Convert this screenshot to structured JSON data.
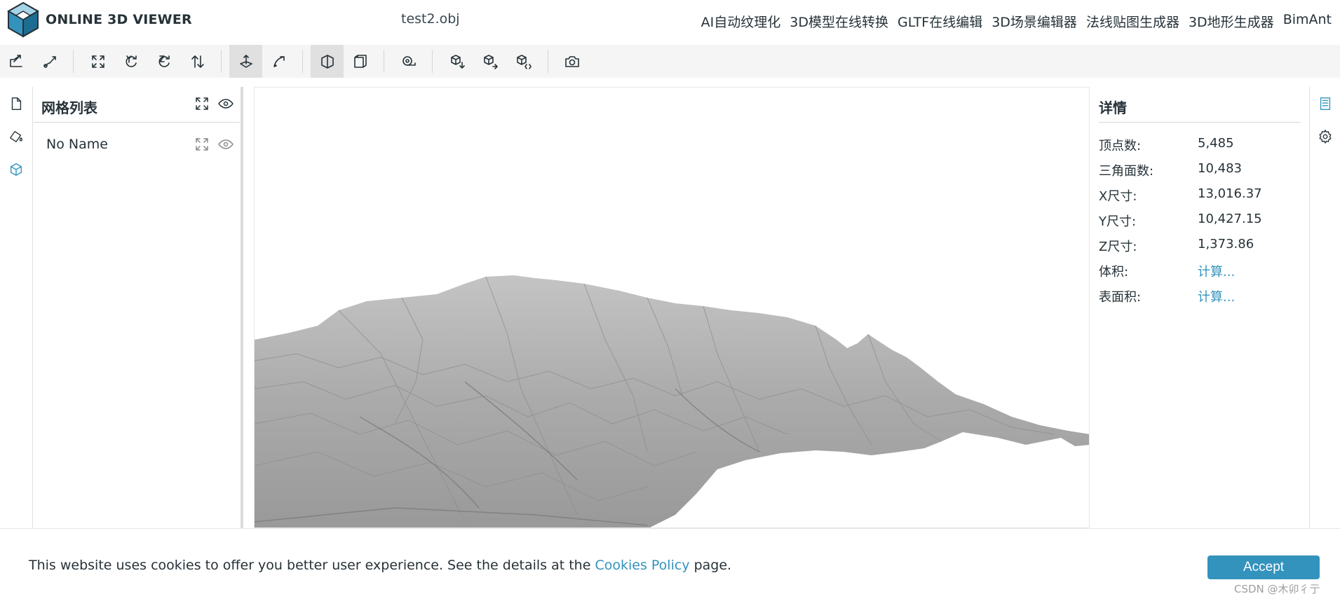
{
  "header": {
    "logo_text": "ONLINE 3D VIEWER",
    "file_title": "test2.obj",
    "nav": [
      "AI自动纹理化",
      "3D模型在线转换",
      "GLTF在线编辑",
      "3D场景编辑器",
      "法线贴图生成器",
      "3D地形生成器",
      "BimAnt"
    ]
  },
  "toolbar": {
    "buttons": [
      {
        "icon": "open-file-icon"
      },
      {
        "icon": "open-url-icon"
      },
      {
        "icon": "fit-to-window-icon"
      },
      {
        "icon": "set-up-y-icon"
      },
      {
        "icon": "set-up-z-icon"
      },
      {
        "icon": "flip-up-icon"
      },
      {
        "icon": "fixed-up-vector-icon",
        "selected": true
      },
      {
        "icon": "free-orbit-icon"
      },
      {
        "icon": "perspective-camera-icon",
        "selected": true
      },
      {
        "icon": "orthographic-camera-icon"
      },
      {
        "icon": "measure-icon"
      },
      {
        "icon": "download-icon"
      },
      {
        "icon": "export-icon"
      },
      {
        "icon": "share-icon"
      },
      {
        "icon": "snapshot-icon"
      }
    ]
  },
  "mesh_panel": {
    "title": "网格列表",
    "items": [
      {
        "name": "No Name"
      }
    ]
  },
  "details": {
    "title": "详情",
    "properties": [
      {
        "name": "顶点数:",
        "value": "5,485"
      },
      {
        "name": "三角面数:",
        "value": "10,483"
      },
      {
        "name": "X尺寸:",
        "value": "13,016.37"
      },
      {
        "name": "Y尺寸:",
        "value": "10,427.15"
      },
      {
        "name": "Z尺寸:",
        "value": "1,373.86"
      },
      {
        "name": "体积:",
        "value": "计算..."
      },
      {
        "name": "表面积:",
        "value": "计算..."
      }
    ]
  },
  "cookie": {
    "text_before": "This website uses cookies to offer you better user experience. See the details at the ",
    "link": "Cookies Policy",
    "text_after": " page.",
    "accept": "Accept"
  },
  "watermark": "CSDN @木卯彳亍",
  "colors": {
    "accent": "#3393bd",
    "text": "#263238",
    "toolbar_bg": "#f5f5f5",
    "terrain": "#a8a8a8"
  }
}
